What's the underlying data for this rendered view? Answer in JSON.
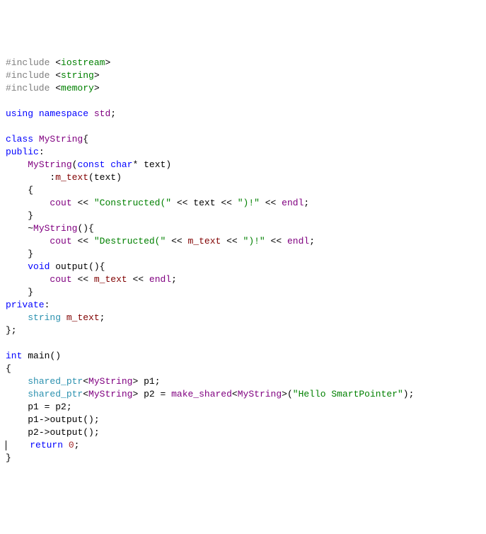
{
  "code": {
    "l1": {
      "pp": "#include ",
      "a": "<",
      "s": "iostream",
      "b": ">"
    },
    "l2": {
      "pp": "#include ",
      "a": "<",
      "s": "string",
      "b": ">"
    },
    "l3": {
      "pp": "#include ",
      "a": "<",
      "s": "memory",
      "b": ">"
    },
    "l5": {
      "k1": "using",
      "sp1": " ",
      "k2": "namespace",
      "sp2": " ",
      "ns": "std",
      "sc": ";"
    },
    "l7": {
      "k": "class",
      "sp": " ",
      "name": "MyString",
      "br": "{"
    },
    "l8": {
      "k": "public",
      "c": ":"
    },
    "l9": {
      "ind": "    ",
      "name": "MyString",
      "op": "(",
      "k": "const",
      "sp": " ",
      "t": "char",
      "st": "* ",
      "p": "text",
      "cp": ")"
    },
    "l10": {
      "ind": "        :",
      "m": "m_text",
      "op": "(",
      "p": "text",
      "cp": ")"
    },
    "l11": {
      "ind": "    {"
    },
    "l12": {
      "ind": "        ",
      "c": "cout",
      "o1": " << ",
      "s1": "\"Constructed(\"",
      "o2": " << ",
      "p": "text",
      "o3": " << ",
      "s2": "\")!\"",
      "o4": " << ",
      "e": "endl",
      "sc": ";"
    },
    "l13": {
      "ind": "    }"
    },
    "l14": {
      "ind": "    ~",
      "name": "MyString",
      "op": "()",
      "br": "{"
    },
    "l15": {
      "ind": "        ",
      "c": "cout",
      "o1": " << ",
      "s1": "\"Destructed(\"",
      "o2": " << ",
      "m": "m_text",
      "o3": " << ",
      "s2": "\")!\"",
      "o4": " << ",
      "e": "endl",
      "sc": ";"
    },
    "l16": {
      "ind": "    }"
    },
    "l17": {
      "ind": "    ",
      "k": "void",
      "sp": " ",
      "fn": "output",
      "op": "()",
      "br": "{"
    },
    "l18": {
      "ind": "        ",
      "c": "cout",
      "o1": " << ",
      "m": "m_text",
      "o2": " << ",
      "e": "endl",
      "sc": ";"
    },
    "l19": {
      "ind": "    }"
    },
    "l20": {
      "k": "private",
      "c": ":"
    },
    "l21": {
      "ind": "    ",
      "t": "string",
      "sp": " ",
      "m": "m_text",
      "sc": ";"
    },
    "l22": {
      "br": "};"
    },
    "l24": {
      "t": "int",
      "sp": " ",
      "fn": "main",
      "op": "()"
    },
    "l25": {
      "br": "{"
    },
    "l26": {
      "ind": "    ",
      "t": "shared_ptr",
      "o1": "<",
      "c": "MyString",
      "o2": "> ",
      "v": "p1",
      "sc": ";"
    },
    "l27": {
      "ind": "    ",
      "t": "shared_ptr",
      "o1": "<",
      "c": "MyString",
      "o2": "> ",
      "v": "p2",
      "eq": " = ",
      "fn": "make_shared",
      "o3": "<",
      "c2": "MyString",
      "o4": ">(",
      "s": "\"Hello SmartPointer\"",
      "cp": ")",
      "sc": ";"
    },
    "l28": {
      "ind": "    ",
      "v1": "p1",
      "eq": " = ",
      "v2": "p2",
      "sc": ";"
    },
    "l29": {
      "ind": "    ",
      "v": "p1",
      "ar": "->",
      "fn": "output",
      "op": "()",
      "sc": ";"
    },
    "l30": {
      "ind": "    ",
      "v": "p2",
      "ar": "->",
      "fn": "output",
      "op": "()",
      "sc": ";"
    },
    "l31": {
      "ind": "    ",
      "k": "return",
      "sp": " ",
      "n": "0",
      "sc": ";"
    },
    "l32": {
      "br": "}"
    }
  }
}
